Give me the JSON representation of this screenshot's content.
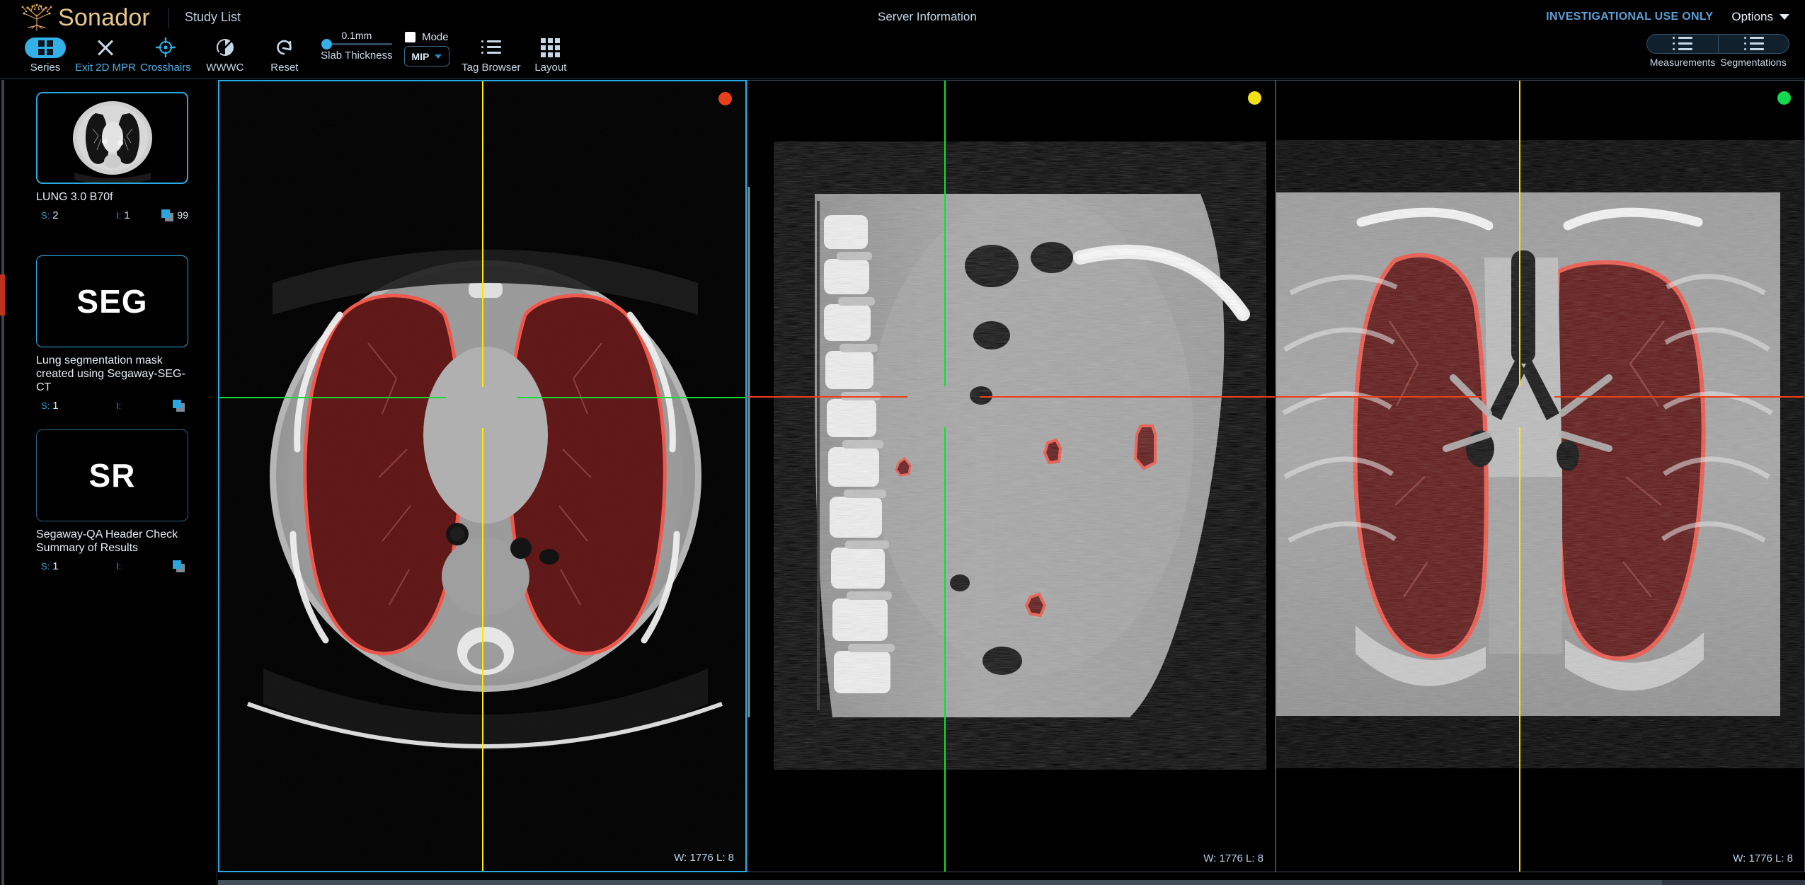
{
  "app": {
    "brand": "Sonador",
    "study_list_label": "Study List",
    "server_information": "Server Information",
    "investigational_notice": "INVESTIGATIONAL USE ONLY",
    "options_label": "Options"
  },
  "toolbar": {
    "tools": [
      {
        "label": "Series",
        "icon": "grid-series-icon",
        "active": true,
        "style": "pill"
      },
      {
        "label": "Exit 2D MPR",
        "icon": "close-x-icon",
        "active": false,
        "style": "icon"
      },
      {
        "label": "Crosshairs",
        "icon": "crosshairs-icon",
        "active": true,
        "style": "icon"
      },
      {
        "label": "WWWC",
        "icon": "contrast-circle-icon",
        "active": false,
        "style": "icon"
      },
      {
        "label": "Reset",
        "icon": "reset-undo-icon",
        "active": false,
        "style": "icon"
      }
    ],
    "slab": {
      "value_label": "0.1mm",
      "label": "Slab Thickness",
      "slider_percent": 0
    },
    "mode": {
      "checkbox_label": "Mode",
      "checked": true,
      "projection_value": "MIP"
    },
    "tag_browser_label": "Tag Browser",
    "layout_label": "Layout",
    "panels": {
      "measurements_label": "Measurements",
      "segmentations_label": "Segmentations"
    }
  },
  "sidebar": {
    "thumbnails": [
      {
        "modality_text": "",
        "title": "LUNG 3.0 B70f",
        "series_key": "S:",
        "series_value": "2",
        "instance_key": "I:",
        "instance_value": "1",
        "frame_count": "99",
        "selected": true,
        "kind": "image"
      },
      {
        "modality_text": "SEG",
        "title": "Lung segmentation mask created using Segaway-SEG-CT",
        "series_key": "S:",
        "series_value": "1",
        "instance_key": "I:",
        "instance_value": "",
        "frame_count": "",
        "selected": false,
        "kind": "seg"
      },
      {
        "modality_text": "SR",
        "title": "Segaway-QA Header Check Summary of Results",
        "series_key": "S:",
        "series_value": "1",
        "instance_key": "I:",
        "instance_value": "",
        "frame_count": "",
        "selected": false,
        "kind": "sr"
      }
    ]
  },
  "viewports": [
    {
      "name": "axial",
      "dot_color": "#e8401a",
      "wl_text": "W: 1776 L: 8",
      "active": true,
      "crosshair_vertical_color": "#ffe800",
      "crosshair_horizontal_color": "#12e02f"
    },
    {
      "name": "sagittal",
      "dot_color": "#f2e018",
      "wl_text": "W: 1776 L: 8",
      "active": false,
      "crosshair_vertical_color": "#12e02f",
      "crosshair_horizontal_color": "#e8401a"
    },
    {
      "name": "coronal",
      "dot_color": "#14d94f",
      "wl_text": "W: 1776 L: 8",
      "active": false,
      "crosshair_vertical_color": "#ffe800",
      "crosshair_horizontal_color": "#e8401a"
    }
  ],
  "colors": {
    "accent": "#33b0e8",
    "brand": "#e8c88a",
    "segmentation_outline": "#f0564a",
    "segmentation_fill": "#5e1414"
  }
}
